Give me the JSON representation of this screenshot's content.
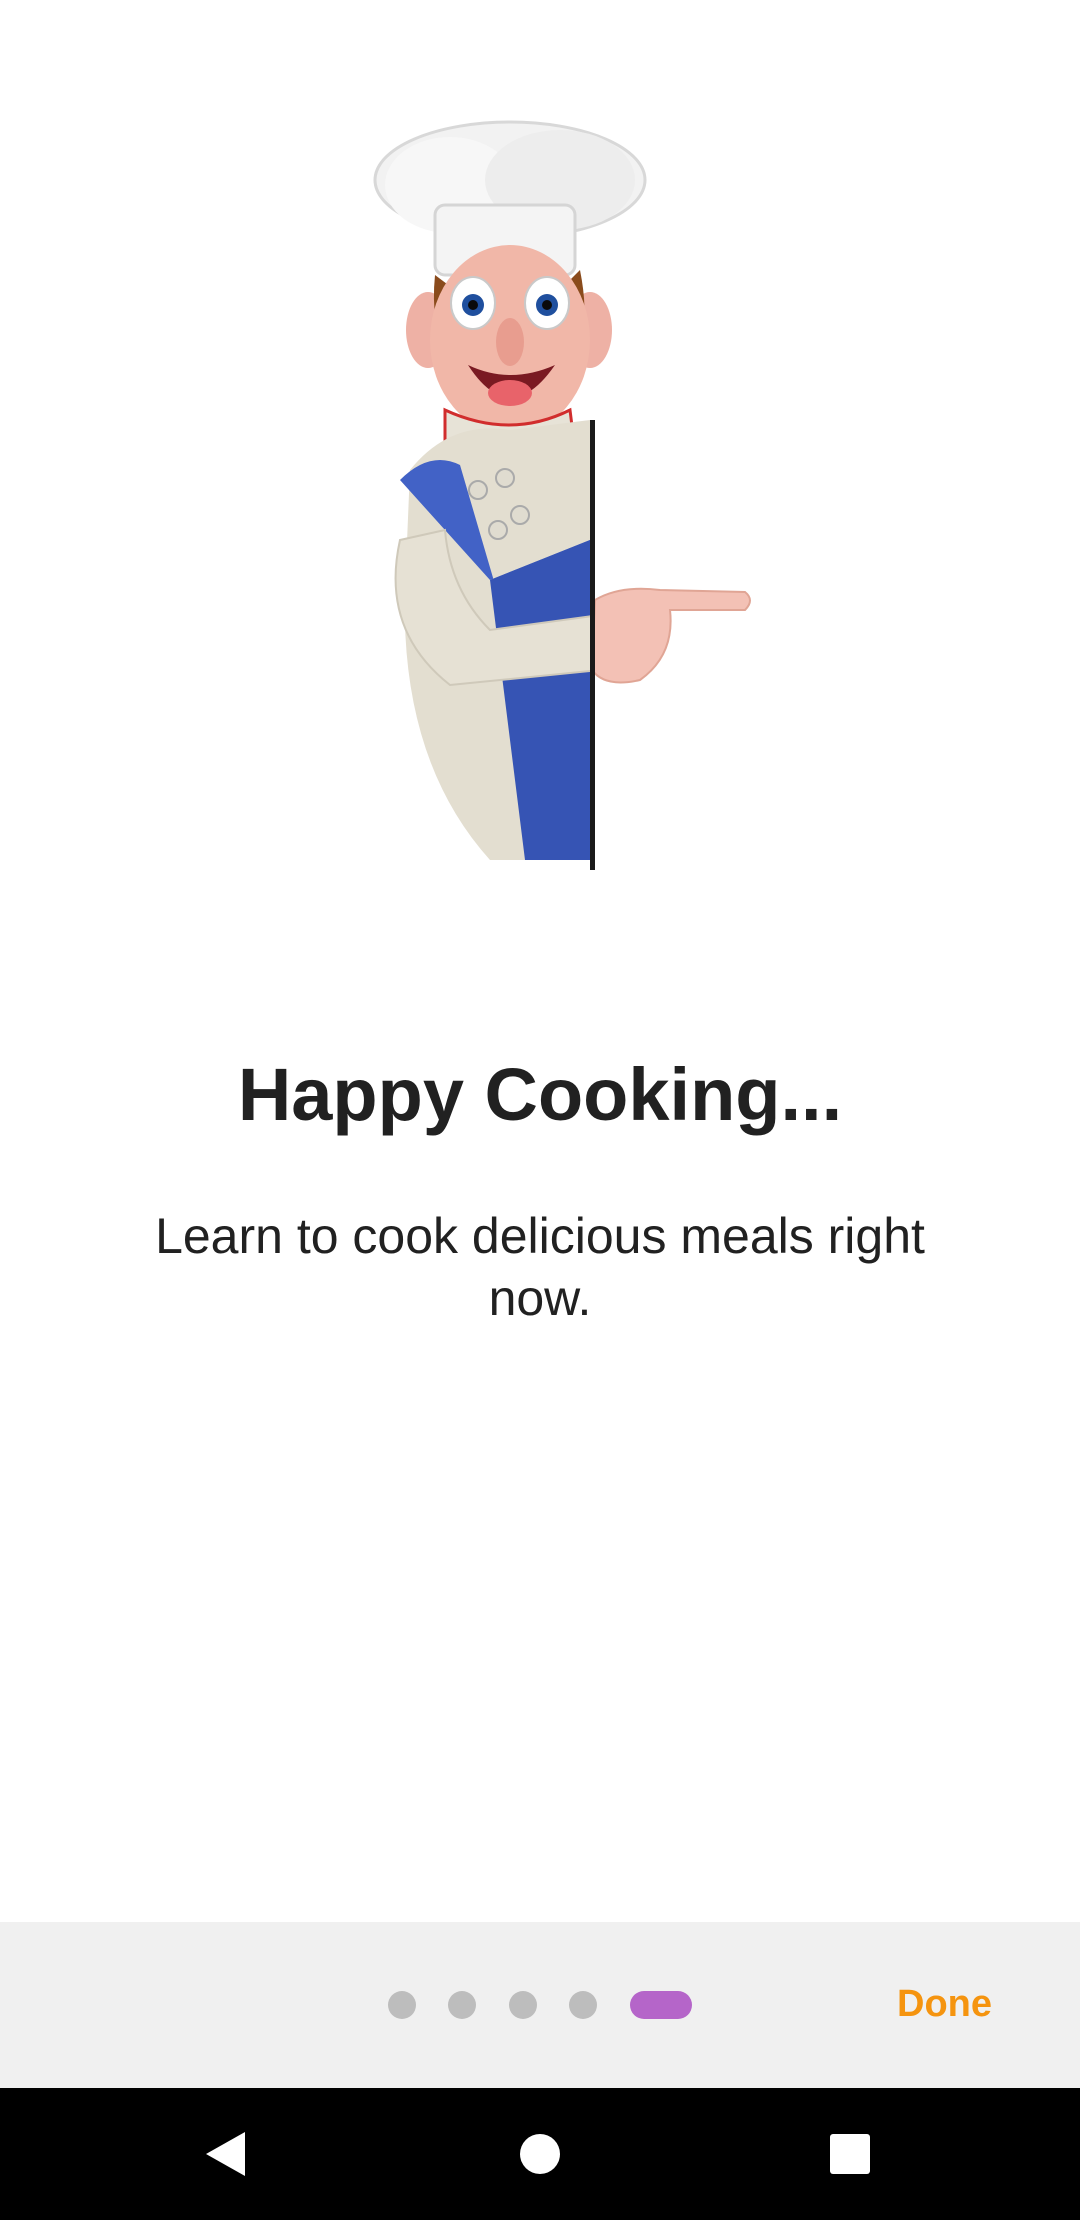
{
  "onboarding": {
    "title": "Happy Cooking...",
    "description": "Learn to cook delicious meals right now.",
    "illustration": "chef-pointing-illustration"
  },
  "pager": {
    "total_pages": 5,
    "current_page": 5,
    "dot_color": "#bdbdbd",
    "active_color": "#b565c9"
  },
  "bottom_bar": {
    "done_label": "Done",
    "done_color": "#f5940f"
  },
  "nav_bar": {
    "back_icon": "back-triangle-icon",
    "home_icon": "home-circle-icon",
    "recents_icon": "recents-square-icon"
  }
}
